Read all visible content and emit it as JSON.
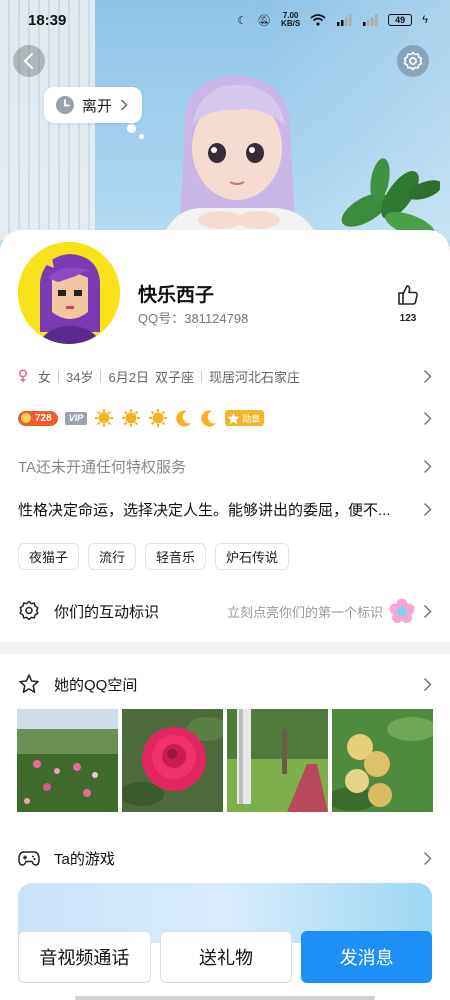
{
  "status_bar": {
    "time": "18:39",
    "net_speed_value": "7.00",
    "net_speed_unit": "KB/S",
    "battery": "49"
  },
  "hero": {
    "online_status": "离开"
  },
  "profile": {
    "nickname": "快乐西子",
    "qq_number": "QQ号：381124798",
    "like_count": "123"
  },
  "info": {
    "gender": "女",
    "age": "34岁",
    "birthday": "6月2日",
    "zodiac": "双子座",
    "residence": "现居河北石家庄"
  },
  "badges": {
    "level": "728",
    "vip": "VIP",
    "medal": "勋章"
  },
  "privilege": {
    "text": "TA还未开通任何特权服务"
  },
  "signature": {
    "text": "性格决定命运，选择决定人生。能够讲出的委屈，便不..."
  },
  "tags": [
    "夜猫子",
    "流行",
    "轻音乐",
    "炉石传说"
  ],
  "interaction": {
    "title": "你们的互动标识",
    "hint": "立刻点亮你们的第一个标识"
  },
  "qzone": {
    "title": "她的QQ空间"
  },
  "games": {
    "title": "Ta的游戏"
  },
  "actions": {
    "call": "音视频通话",
    "gift": "送礼物",
    "message": "发消息"
  },
  "colors": {
    "accent": "#1e8ff6",
    "level_badge": "#f05a2d",
    "avatar_bg": "#f7e21c"
  }
}
